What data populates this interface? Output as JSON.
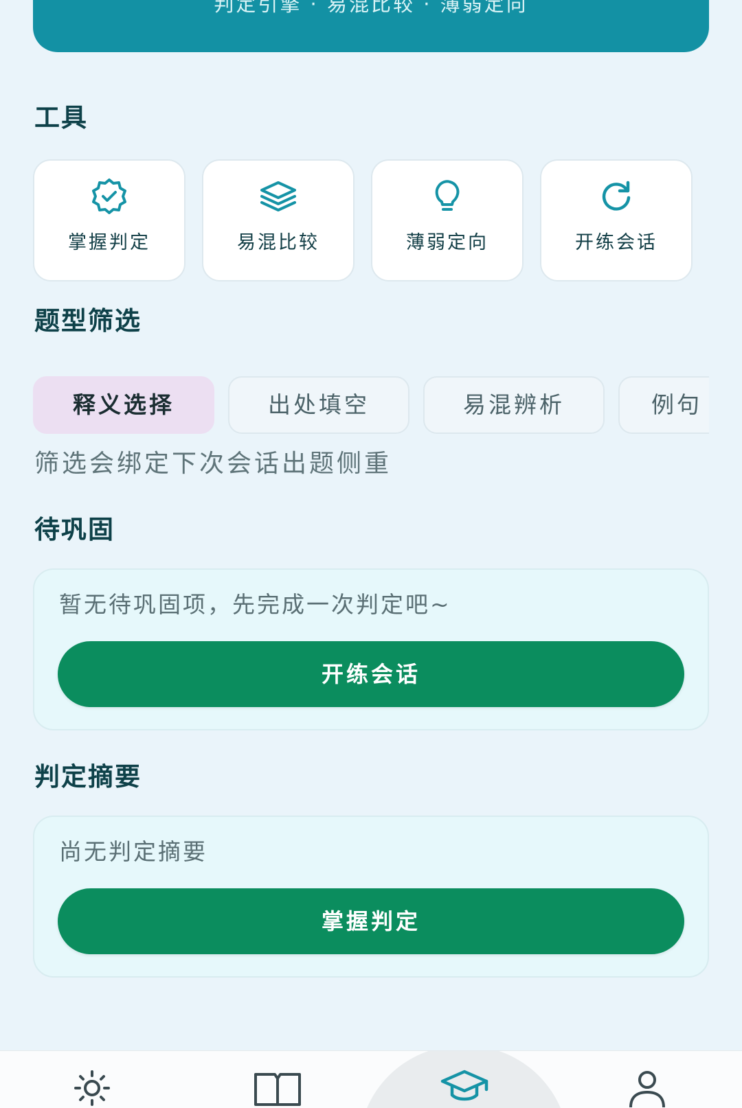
{
  "banner": {
    "subtitle": "判定引擎 · 易混比较 · 薄弱定向"
  },
  "tools": {
    "title": "工具",
    "items": [
      {
        "label": "掌握判定",
        "icon": "badge-check-icon"
      },
      {
        "label": "易混比较",
        "icon": "layers-icon"
      },
      {
        "label": "薄弱定向",
        "icon": "lightbulb-icon"
      },
      {
        "label": "开练会话",
        "icon": "refresh-icon"
      }
    ]
  },
  "filter": {
    "title": "题型筛选",
    "chips": [
      {
        "label": "释义选择",
        "selected": true
      },
      {
        "label": "出处填空",
        "selected": false
      },
      {
        "label": "易混辨析",
        "selected": false
      },
      {
        "label": "例句",
        "selected": false
      }
    ],
    "hint": "筛选会绑定下次会话出题侧重"
  },
  "pending": {
    "title": "待巩固",
    "empty_text": "暂无待巩固项，先完成一次判定吧~",
    "button_label": "开练会话"
  },
  "summary": {
    "title": "判定摘要",
    "empty_text": "尚无判定摘要",
    "button_label": "掌握判定"
  },
  "bottom_nav": {
    "items": [
      {
        "icon": "sun-icon",
        "active": false
      },
      {
        "icon": "book-icon",
        "active": false
      },
      {
        "icon": "graduation-cap-icon",
        "active": true
      },
      {
        "icon": "user-icon",
        "active": false
      }
    ]
  },
  "colors": {
    "accent_teal": "#1391a4",
    "primary_green": "#0b8d5e",
    "chip_selected": "#ecdff2",
    "background": "#eaf4fa"
  }
}
